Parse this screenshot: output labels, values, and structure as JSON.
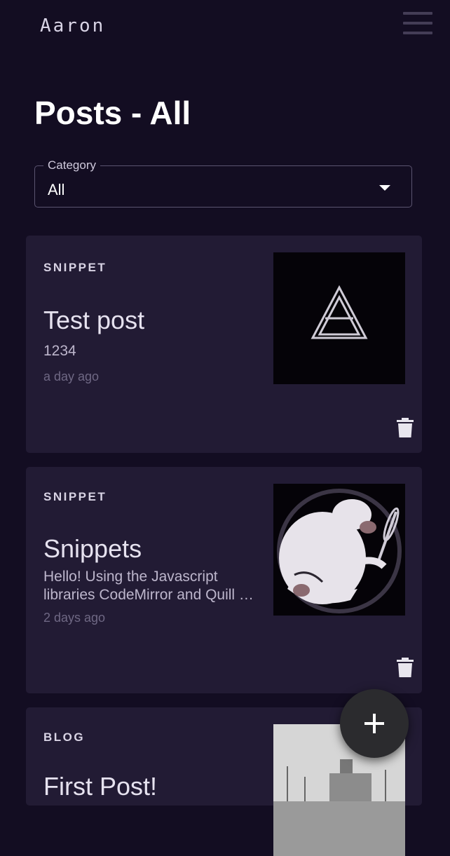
{
  "app": {
    "brand": "Aaron"
  },
  "page": {
    "title": "Posts - All"
  },
  "filter": {
    "label": "Category",
    "value": "All"
  },
  "posts": [
    {
      "category": "SNIPPET",
      "title": "Test post",
      "excerpt": "1234",
      "time": "a day ago",
      "thumb_icon": "triangle-logo"
    },
    {
      "category": "SNIPPET",
      "title": "Snippets",
      "excerpt": "Hello! Using the Javascript libraries CodeMirror and Quill …",
      "time": "2 days ago",
      "thumb_icon": "ferret-magnifier"
    },
    {
      "category": "BLOG",
      "title": "First Post!",
      "excerpt": "",
      "time": "",
      "thumb_icon": "ship-photo"
    }
  ],
  "fab": {
    "icon": "plus-icon"
  },
  "icons": {
    "delete": "trash-icon",
    "menu": "menu-icon"
  }
}
